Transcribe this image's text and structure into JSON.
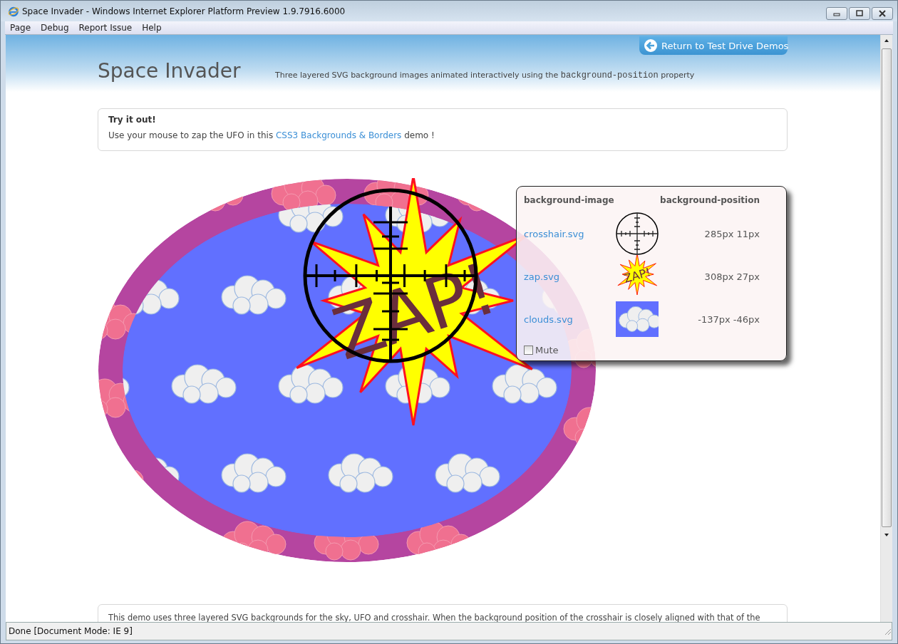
{
  "window": {
    "title": "Space Invader - Windows Internet Explorer Platform Preview 1.9.7916.6000"
  },
  "menu": [
    "Page",
    "Debug",
    "Report Issue",
    "Help"
  ],
  "return_button": "Return to Test Drive Demos",
  "page_title": "Space Invader",
  "subtitle": {
    "before": "Three layered SVG background images animated interactively using the",
    "code": "background-position",
    "after": "property"
  },
  "try_box": {
    "heading": "Try it out!",
    "text_before": "Use your mouse to zap the UFO in this",
    "link": "CSS3 Backgrounds & Borders",
    "text_after": "demo !"
  },
  "scene": {
    "zap_text": "ZAP!"
  },
  "panel": {
    "columns": [
      "background-image",
      "background-position"
    ],
    "rows": [
      {
        "kind": "crosshair",
        "file": "crosshair.svg",
        "position": "285px 11px"
      },
      {
        "kind": "zap",
        "file": "zap.svg",
        "position": "308px 27px",
        "thumb_text": "ZAP!"
      },
      {
        "kind": "clouds",
        "file": "clouds.svg",
        "position": "-137px -46px"
      }
    ],
    "mute": {
      "label": "Mute",
      "checked": false
    }
  },
  "description": "This demo uses three layered SVG backgrounds for the sky, UFO and crosshair. When the background position of the crosshair is closely aligned with that of the",
  "status_bar": "Done [Document Mode: IE 9]"
}
